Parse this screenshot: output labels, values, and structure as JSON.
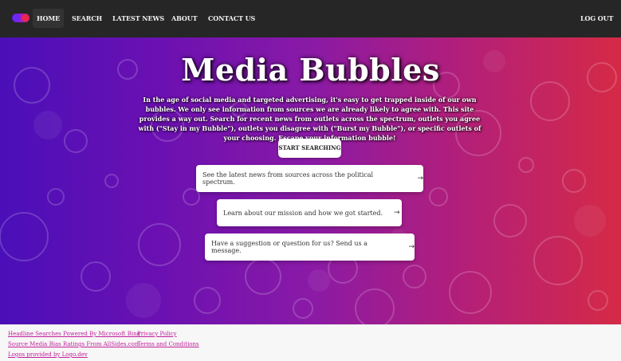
{
  "navbar": {
    "items": [
      {
        "label": "HOME",
        "active": true
      },
      {
        "label": "SEARCH",
        "active": false
      },
      {
        "label": "LATEST NEWS",
        "active": false
      },
      {
        "label": "ABOUT",
        "active": false
      },
      {
        "label": "CONTACT US",
        "active": false
      }
    ],
    "logout_label": "LOG OUT",
    "background": "#262626"
  },
  "hero": {
    "title": "Media Bubbles",
    "description": "In the age of social media and targeted advertising, it's easy to get trapped inside of our own bubbles. We only see information from sources we are already likely to agree with. This site provides a way out. Search for recent news from outlets across the spectrum, outlets you agree with (\"Stay in my Bubble\"), outlets you disagree with (\"Burst my Bubble\"), or specific outlets of your choosing. Escape your information bubble!",
    "start_button_label": "START SEARCHING",
    "gradient_colors": [
      "#4a0fb8",
      "#8a1aa6",
      "#d52a46"
    ],
    "cards": [
      {
        "text": "See the latest news from sources across the political spectrum.",
        "icon": "arrow-right-icon"
      },
      {
        "text": "Learn about our mission and how we got started.",
        "icon": "arrow-right-icon"
      },
      {
        "text": "Have a suggestion or question for us? Send us a message.",
        "icon": "arrow-right-icon"
      }
    ]
  },
  "footer": {
    "links": {
      "bing": "Headline Searches Powered By Microsoft Bing",
      "bias": "Source Media Bias Ratings From AllSides.com",
      "logos": "Logos provided by Logo.dev",
      "privacy": "Privacy Policy",
      "terms": "Terms and Conditions"
    },
    "link_color": "#c0209a"
  }
}
